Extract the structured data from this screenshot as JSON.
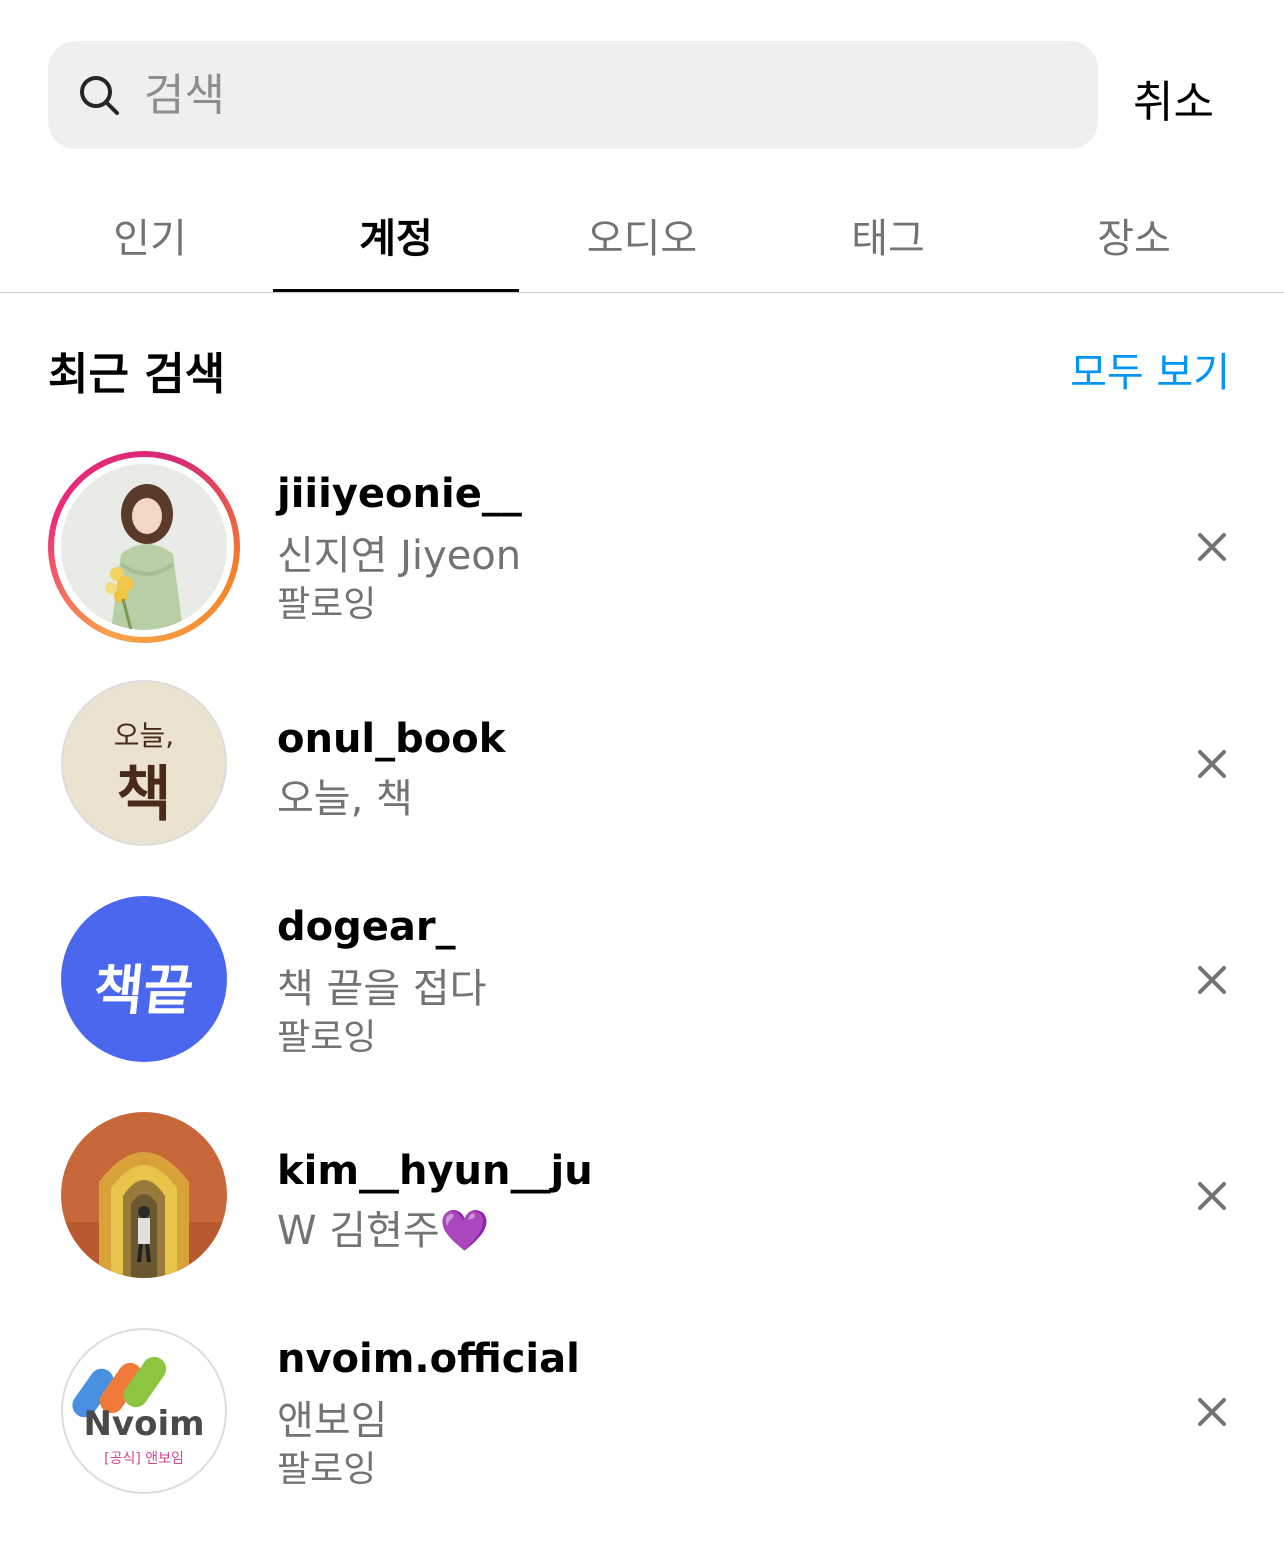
{
  "search": {
    "placeholder": "검색",
    "cancel_label": "취소"
  },
  "tabs": [
    {
      "label": "인기",
      "active": false
    },
    {
      "label": "계정",
      "active": true
    },
    {
      "label": "오디오",
      "active": false
    },
    {
      "label": "태그",
      "active": false
    },
    {
      "label": "장소",
      "active": false
    }
  ],
  "recent": {
    "title": "최근 검색",
    "see_all_label": "모두 보기",
    "items": [
      {
        "username": "jiiiyeonie__",
        "fullname": "신지연 Jiyeon",
        "status": "팔로잉",
        "avatar": "photo-woman-flowers",
        "story_ring": true
      },
      {
        "username": "onul_book",
        "fullname": "오늘, 책",
        "status": "",
        "avatar_text_small": "오늘,",
        "avatar_text_large": "책"
      },
      {
        "username": "dogear_",
        "fullname": "책 끝을 접다",
        "status": "팔로잉",
        "avatar_text": "책끝"
      },
      {
        "username": "kim__hyun__ju",
        "fullname": "W 김현주💜",
        "status": "",
        "avatar": "photo-person-archway"
      },
      {
        "username": "nvoim.official",
        "fullname": "앤보임",
        "status": "팔로잉",
        "avatar_logo_text": "Nvoim",
        "avatar_sub_text": "[공식] 앤보임"
      }
    ]
  },
  "colors": {
    "accent_link": "#0095f6",
    "secondary_text": "#737373",
    "search_bg": "#efefef",
    "dogear_bg": "#4a67ee",
    "onul_bg": "#ece2d0"
  }
}
